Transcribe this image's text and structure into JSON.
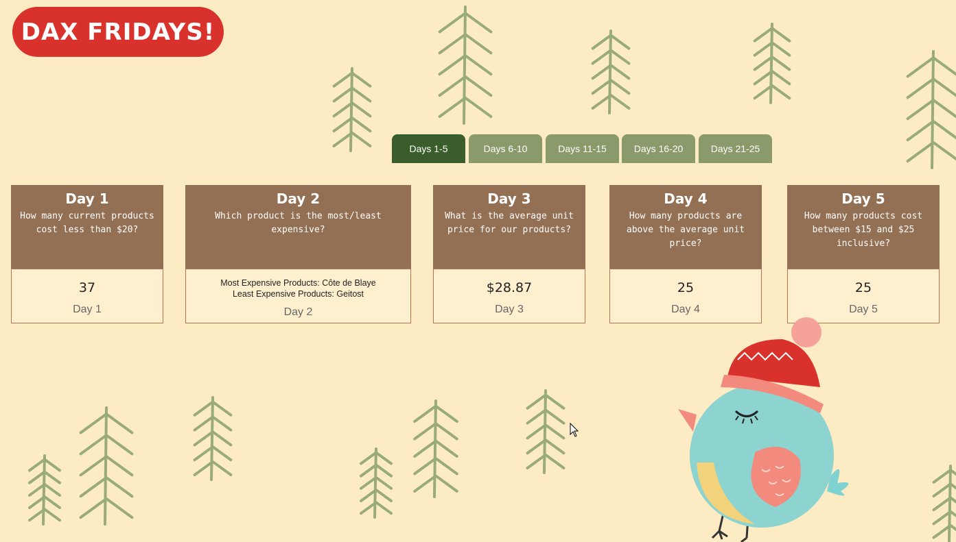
{
  "header": {
    "title": "DAX FRIDAYS!"
  },
  "tabs": [
    {
      "label": "Days 1-5",
      "active": true
    },
    {
      "label": "Days 6-10",
      "active": false
    },
    {
      "label": "Days 11-15",
      "active": false
    },
    {
      "label": "Days 16-20",
      "active": false
    },
    {
      "label": "Days 21-25",
      "active": false
    }
  ],
  "cards": [
    {
      "title": "Day 1",
      "question": "How many current products cost less than $20?",
      "value": "37",
      "footer": "Day 1"
    },
    {
      "title": "Day 2",
      "question": "Which product is the most/least expensive?",
      "value_line1": "Most Expensive Products: Côte de Blaye",
      "value_line2": "Least Expensive Products: Geitost",
      "footer": "Day 2"
    },
    {
      "title": "Day 3",
      "question": "What is the average unit price for our products?",
      "value": "$28.87",
      "footer": "Day 3"
    },
    {
      "title": "Day 4",
      "question": "How many products are above the average unit price?",
      "value": "25",
      "footer": "Day 4"
    },
    {
      "title": "Day 5",
      "question": "How many products cost between $15 and $25 inclusive?",
      "value": "25",
      "footer": "Day 5"
    }
  ],
  "colors": {
    "background": "#fdebc4",
    "title_pill": "#d9322c",
    "tab_active": "#3a5e2b",
    "tab_inactive": "#8a9a6a",
    "card_header": "#937053",
    "tree": "#9aab7a"
  },
  "icons": [
    "pine-tree-icon",
    "bird-with-hat-icon",
    "mouse-cursor-icon"
  ]
}
